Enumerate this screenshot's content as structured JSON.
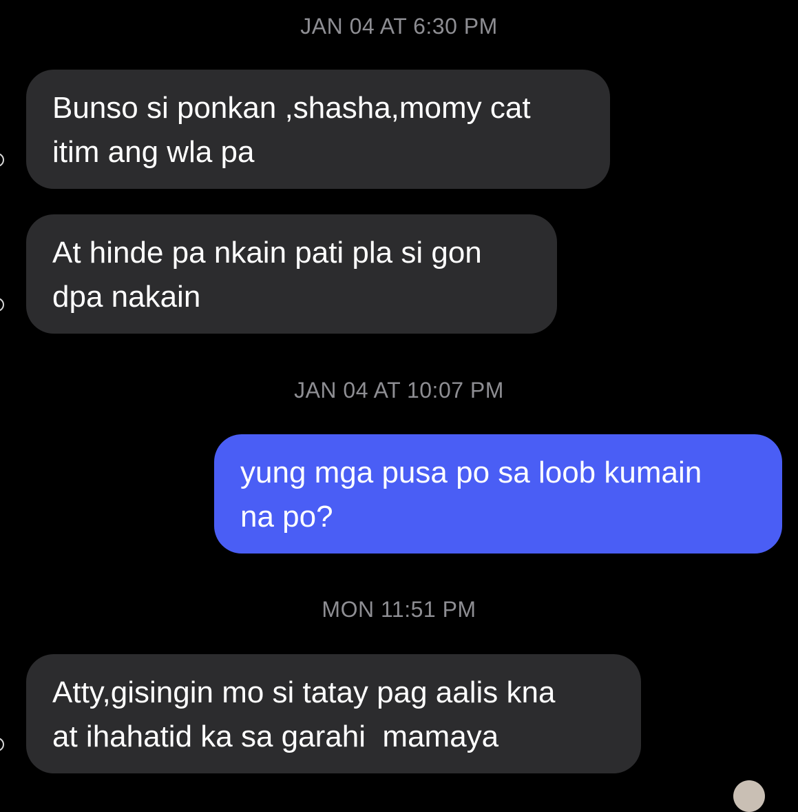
{
  "conversation": {
    "timestamps": [
      "JAN 04 AT 6:30 PM",
      "JAN 04 AT 10:07 PM",
      "MON 11:51 PM"
    ],
    "messages": [
      {
        "direction": "incoming",
        "text": "Bunso si ponkan ,shasha,momy cat\nitim ang wla pa"
      },
      {
        "direction": "incoming",
        "text": "At hinde pa nkain pati pla si gon\ndpa nakain"
      },
      {
        "direction": "outgoing",
        "text": "yung mga pusa po sa loob kumain\nna po?"
      },
      {
        "direction": "incoming",
        "text": "Atty,gisingin mo si tatay pag aalis kna\nat ihahatid ka sa garahi  mamaya"
      }
    ]
  },
  "colors": {
    "background": "#000000",
    "incoming_bubble": "#2c2c2e",
    "outgoing_bubble": "#4a5ef5",
    "timestamp_text": "#8e8e93"
  }
}
